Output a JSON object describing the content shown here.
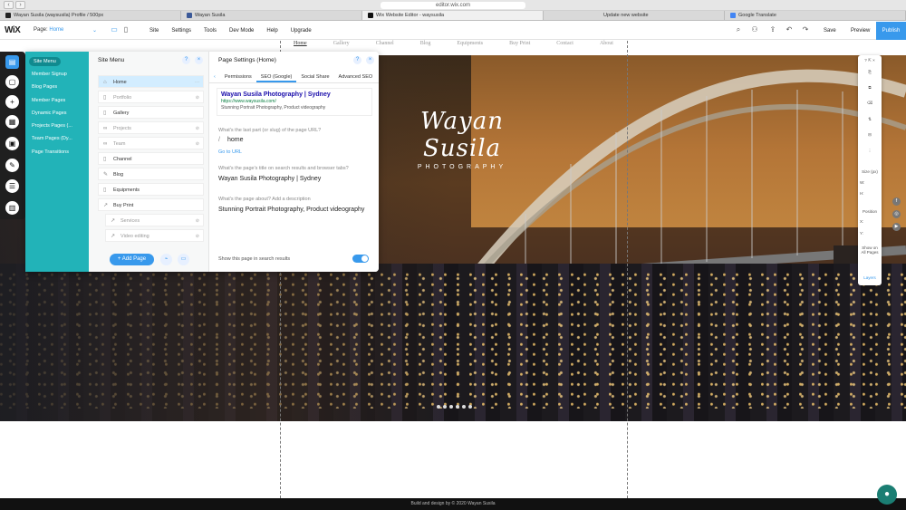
{
  "browser": {
    "url": "editor.wix.com",
    "tabs": [
      {
        "label": "Wayan Susila (waysusila) Profile / 500px",
        "color": "#222222"
      },
      {
        "label": "Wayan Susila",
        "color": "#3b5998"
      },
      {
        "label": "Wix Website Editor - waysusila",
        "color": "#111111"
      },
      {
        "label": "Update new website",
        "color": "#888888"
      },
      {
        "label": "Google Translate",
        "color": "#4285f4"
      }
    ]
  },
  "topbar": {
    "logo": "WiX",
    "page_label": "Page:",
    "page_value": "Home",
    "menu": [
      "Site",
      "Settings",
      "Tools",
      "Dev Mode",
      "Help",
      "Upgrade"
    ],
    "save": "Save",
    "preview": "Preview",
    "publish": "Publish",
    "accent": "#3899ec"
  },
  "site_nav": [
    "Home",
    "Gallery",
    "Channel",
    "Blog",
    "Equipments",
    "Buy Print",
    "Contact",
    "About"
  ],
  "hero_logo": {
    "name": "Wayan Susila",
    "sub": "PHOTOGRAPHY"
  },
  "site_menu": {
    "categories": [
      "Site Menu",
      "Member Signup",
      "Blog Pages",
      "Member Pages",
      "Dynamic Pages",
      "Projects Pages (...",
      "Team Pages (Dy...",
      "Page Transitions"
    ],
    "title": "Site Menu",
    "pages": [
      {
        "label": "Home",
        "type": "home"
      },
      {
        "label": "Portfolio",
        "type": "hidden"
      },
      {
        "label": "Gallery",
        "type": "normal"
      },
      {
        "label": "Projects",
        "type": "hidden"
      },
      {
        "label": "Team",
        "type": "hidden"
      },
      {
        "label": "Channel",
        "type": "normal"
      },
      {
        "label": "Blog",
        "type": "normal"
      },
      {
        "label": "Equipments",
        "type": "normal"
      },
      {
        "label": "Buy Print",
        "type": "normal"
      },
      {
        "label": "Services",
        "type": "sub"
      },
      {
        "label": "Video editing",
        "type": "sub"
      }
    ],
    "add_page": "+ Add Page"
  },
  "page_settings": {
    "title": "Page Settings (Home)",
    "tabs": [
      "Permissions",
      "SEO (Google)",
      "Social Share",
      "Advanced SEO"
    ],
    "serp": {
      "title": "Wayan Susila Photography | Sydney",
      "url": "https://www.waysusila.com/",
      "desc": "Stunning Portrait Photography, Product videography"
    },
    "q_url": "What's the last part (or slug) of the page URL?",
    "slug_prefix": "/",
    "slug": "home",
    "goto": "Go to URL",
    "q_title": "What's the page's title on search results and browser tabs?",
    "title_value": "Wayan Susila Photography | Sydney",
    "q_desc": "What's the page about? Add a description",
    "desc_value": "Stunning Portrait Photography, Product videography",
    "show_label": "Show this page in search results",
    "show_on": true
  },
  "inspector": {
    "size_label": "Size (px)",
    "w": "W:",
    "h": "H:",
    "position_label": "Position",
    "x": "X:",
    "y": "Y:",
    "show_all": "Show on All Pages",
    "layers": "Layers"
  },
  "footer": "Build and design by © 2020 Wayan Susila"
}
